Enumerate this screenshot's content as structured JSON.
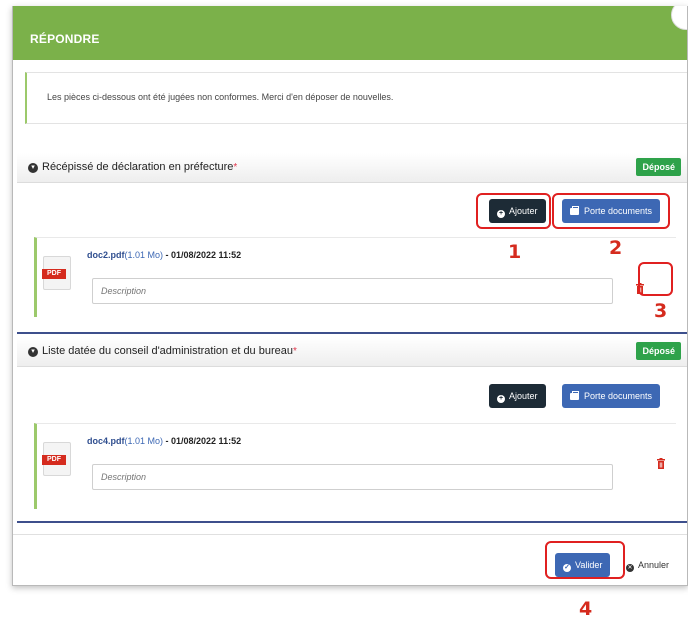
{
  "modal": {
    "title": "RÉPONDRE",
    "notice": "Les pièces ci-dessous ont été jugées non conformes. Merci d'en déposer de nouvelles."
  },
  "sections": [
    {
      "title": "Récépissé de déclaration en préfecture",
      "required_mark": "*",
      "status": "Déposé",
      "add_label": "Ajouter",
      "folder_label": "Porte documents",
      "file": {
        "name": "doc2.pdf",
        "size": "(1.01 Mo)",
        "separator": " - ",
        "date": "01/08/2022 11:52",
        "type_label": "PDF",
        "description_placeholder": "Description"
      }
    },
    {
      "title": "Liste datée du conseil d'administration et du bureau",
      "required_mark": "*",
      "status": "Déposé",
      "add_label": "Ajouter",
      "folder_label": "Porte documents",
      "file": {
        "name": "doc4.pdf",
        "size": "(1.01 Mo)",
        "separator": " - ",
        "date": "01/08/2022 11:52",
        "type_label": "PDF",
        "description_placeholder": "Description"
      }
    }
  ],
  "footer": {
    "validate_label": "Valider",
    "cancel_label": "Annuler"
  },
  "annotations": {
    "n1": "1",
    "n2": "2",
    "n3": "3",
    "n4": "4"
  },
  "colors": {
    "header": "#7bb14a",
    "badge": "#2ea24a",
    "primary": "#3d68b4",
    "dark_button": "#1d2b36",
    "annotation": "#e02020"
  }
}
